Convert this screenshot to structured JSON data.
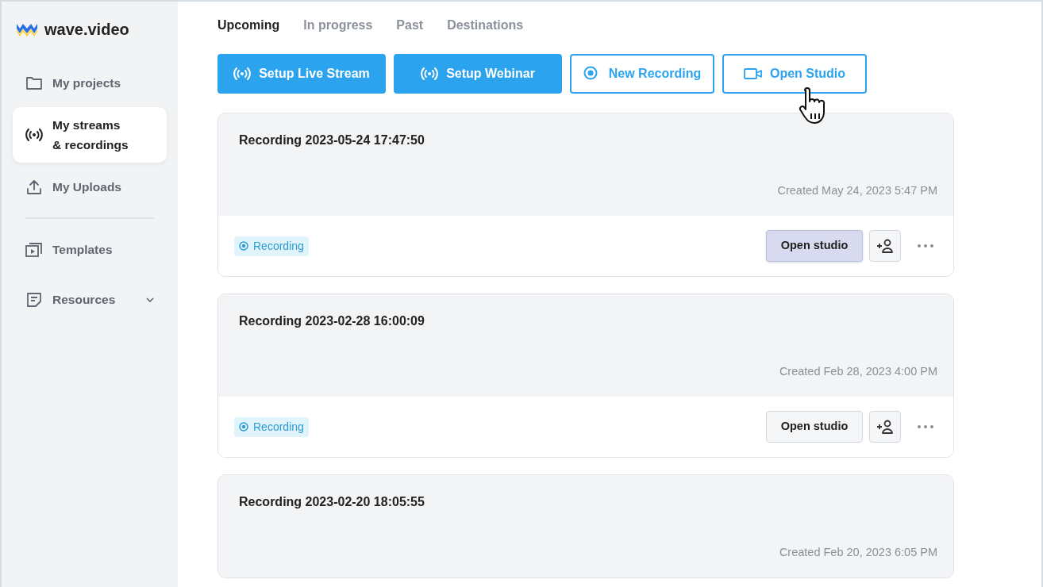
{
  "logo": {
    "text": "wave.video"
  },
  "sidebar": {
    "items": [
      {
        "label": "My projects",
        "selected": false,
        "has_submenu": false
      },
      {
        "label": "My streams\n& recordings",
        "selected": true,
        "has_submenu": false
      },
      {
        "label": "My Uploads",
        "selected": false,
        "has_submenu": false
      },
      {
        "label": "Templates",
        "selected": false,
        "has_submenu": false
      },
      {
        "label": "Resources",
        "selected": false,
        "has_submenu": true
      }
    ]
  },
  "tabs": [
    {
      "label": "Upcoming",
      "selected": true
    },
    {
      "label": "In progress",
      "selected": false
    },
    {
      "label": "Past",
      "selected": false
    },
    {
      "label": "Destinations",
      "selected": false
    }
  ],
  "actions": [
    {
      "label": "Setup Live Stream",
      "kind": "primary"
    },
    {
      "label": "Setup Webinar",
      "kind": "primary"
    },
    {
      "label": "New Recording",
      "kind": "outline"
    },
    {
      "label": "Open Studio",
      "kind": "outline"
    }
  ],
  "recordings": [
    {
      "title": "Recording 2023-05-24 17:47:50",
      "created": "Created May 24, 2023 5:47 PM",
      "status": "Recording",
      "button": "Open studio",
      "hovered": true
    },
    {
      "title": "Recording 2023-02-28 16:00:09",
      "created": "Created Feb 28, 2023 4:00 PM",
      "status": "Recording",
      "button": "Open studio",
      "hovered": false
    },
    {
      "title": "Recording 2023-02-20 18:05:55",
      "created": "Created Feb 20, 2023 6:05 PM"
    }
  ]
}
